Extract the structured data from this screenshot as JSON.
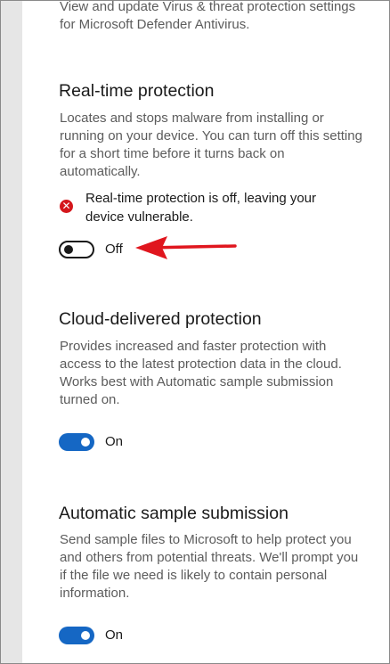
{
  "intro": {
    "text": "View and update Virus & threat protection settings for Microsoft Defender Antivirus."
  },
  "realtime": {
    "heading": "Real-time protection",
    "description": "Locates and stops malware from installing or running on your device. You can turn off this setting for a short time before it turns back on automatically.",
    "warning_icon": "error-x-icon",
    "warning": "Real-time protection is off, leaving your device vulnerable.",
    "toggle_label": "Off",
    "toggle_state": "off"
  },
  "annotation": {
    "arrow_color": "#e0161e"
  },
  "cloud": {
    "heading": "Cloud-delivered protection",
    "description": "Provides increased and faster protection with access to the latest protection data in the cloud. Works best with Automatic sample submission turned on.",
    "toggle_label": "On",
    "toggle_state": "on"
  },
  "sample": {
    "heading": "Automatic sample submission",
    "description": "Send sample files to Microsoft to help protect you and others from potential threats. We'll prompt you if the file we need is likely to contain personal information.",
    "toggle_label": "On",
    "toggle_state": "on"
  },
  "colors": {
    "accent": "#1567c4",
    "error": "#d4171c"
  }
}
